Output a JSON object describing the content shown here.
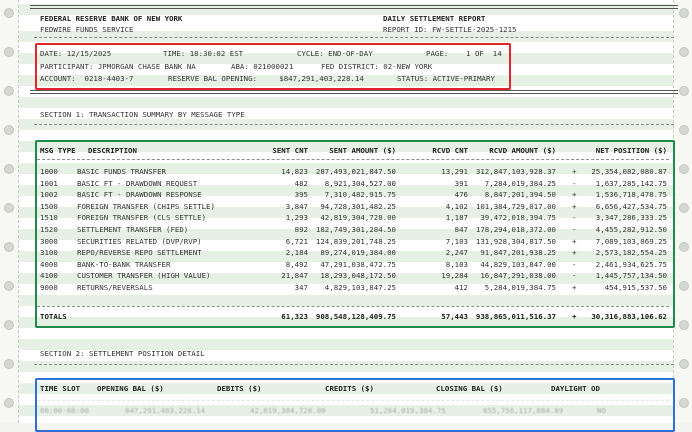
{
  "header": {
    "bank": "FEDERAL RESERVE BANK OF NEW YORK",
    "service": "FEDWIRE FUNDS SERVICE",
    "report_title": "DAILY SETTLEMENT REPORT",
    "report_id": "REPORT ID: FW-SETTLE-2025-1215"
  },
  "info": {
    "date": "DATE: 12/15/2025",
    "time": "TIME: 18:30:02 EST",
    "cycle": "CYCLE: END-OF-DAY",
    "page": "PAGE:    1 OF  14",
    "participant": "PARTICIPANT: JPMORGAN CHASE BANK NA",
    "aba": "ABA: 021000021",
    "district": "FED DISTRICT: 02-NEW YORK",
    "account": "ACCOUNT:  0218-4403-7",
    "reserve": "RESERVE BAL OPENING:     $847,291,403,228.14",
    "status": "STATUS: ACTIVE-PRIMARY"
  },
  "section1": {
    "title": "SECTION 1: TRANSACTION SUMMARY BY MESSAGE TYPE",
    "columns": {
      "msg_type": "MSG TYPE",
      "description": "DESCRIPTION",
      "sent_cnt": "SENT CNT",
      "sent_amount": "SENT AMOUNT ($)",
      "rcvd_cnt": "RCVD CNT",
      "rcvd_amount": "RCVD AMOUNT ($)",
      "net_position": "NET POSITION ($)"
    },
    "rows": [
      {
        "type": "1000",
        "desc": "BASIC FUNDS TRANSFER",
        "sent_cnt": "14,823",
        "sent_amt": "287,493,021,847.50",
        "rcvd_cnt": "13,291",
        "rcvd_amt": "312,847,103,928.37",
        "sign": "+",
        "net": "25,354,082,080.87"
      },
      {
        "type": "1001",
        "desc": "BASIC FT - DRAWDOWN REQUEST",
        "sent_cnt": "482",
        "sent_amt": "8,921,304,527.00",
        "rcvd_cnt": "391",
        "rcvd_amt": "7,284,019,384.25",
        "sign": "-",
        "net": "1,637,285,142.75"
      },
      {
        "type": "1002",
        "desc": "BASIC FT - DRAWDOWN RESPONSE",
        "sent_cnt": "395",
        "sent_amt": "7,310,482,915.75",
        "rcvd_cnt": "476",
        "rcvd_amt": "8,847,201,394.50",
        "sign": "+",
        "net": "1,536,718,478.75"
      },
      {
        "type": "1500",
        "desc": "FOREIGN TRANSFER (CHIPS SETTLE)",
        "sent_cnt": "3,847",
        "sent_amt": "94,728,301,482.25",
        "rcvd_cnt": "4,102",
        "rcvd_amt": "101,384,729,017.00",
        "sign": "+",
        "net": "6,656,427,534.75"
      },
      {
        "type": "1510",
        "desc": "FOREIGN TRANSFER (CLS SETTLE)",
        "sent_cnt": "1,293",
        "sent_amt": "42,819,304,728.00",
        "rcvd_cnt": "1,187",
        "rcvd_amt": "39,472,018,394.75",
        "sign": "-",
        "net": "3,347,286,333.25"
      },
      {
        "type": "1520",
        "desc": "SETTLEMENT TRANSFER (FED)",
        "sent_cnt": "892",
        "sent_amt": "182,749,301,284.50",
        "rcvd_cnt": "847",
        "rcvd_amt": "178,294,018,372.00",
        "sign": "-",
        "net": "4,455,282,912.50"
      },
      {
        "type": "3000",
        "desc": "SECURITIES RELATED (DVP/RVP)",
        "sent_cnt": "6,721",
        "sent_amt": "124,839,201,748.25",
        "rcvd_cnt": "7,103",
        "rcvd_amt": "131,928,304,817.50",
        "sign": "+",
        "net": "7,089,103,069.25"
      },
      {
        "type": "3100",
        "desc": "REPO/REVERSE REPO SETTLEMENT",
        "sent_cnt": "2,184",
        "sent_amt": "89,274,019,384.00",
        "rcvd_cnt": "2,247",
        "rcvd_amt": "91,847,201,938.25",
        "sign": "+",
        "net": "2,573,182,554.25"
      },
      {
        "type": "4000",
        "desc": "BANK-TO-BANK TRANSFER",
        "sent_cnt": "8,492",
        "sent_amt": "47,291,038,472.75",
        "rcvd_cnt": "8,103",
        "rcvd_amt": "44,829,103,847.00",
        "sign": "-",
        "net": "2,461,934,625.75"
      },
      {
        "type": "4100",
        "desc": "CUSTOMER TRANSFER (HIGH VALUE)",
        "sent_cnt": "21,847",
        "sent_amt": "18,293,048,172.50",
        "rcvd_cnt": "19,284",
        "rcvd_amt": "16,847,291,038.00",
        "sign": "-",
        "net": "1,445,757,134.50"
      },
      {
        "type": "9000",
        "desc": "RETURNS/REVERSALS",
        "sent_cnt": "347",
        "sent_amt": "4,829,103,847.25",
        "rcvd_cnt": "412",
        "rcvd_amt": "5,284,019,384.75",
        "sign": "+",
        "net": "454,915,537.50"
      }
    ],
    "totals": {
      "label": "TOTALS",
      "sent_cnt": "61,323",
      "sent_amt": "908,548,128,409.75",
      "rcvd_cnt": "57,443",
      "rcvd_amt": "938,865,011,516.37",
      "sign": "+",
      "net": "30,316,883,106.62"
    }
  },
  "section2": {
    "title": "SECTION 2: SETTLEMENT POSITION DETAIL",
    "columns": {
      "time_slot": "TIME SLOT",
      "opening": "OPENING BAL ($)",
      "debits": "DEBITS ($)",
      "credits": "CREDITS ($)",
      "closing": "CLOSING BAL ($)",
      "daylight": "DAYLIGHT OD"
    },
    "rows": [
      {
        "slot": "06:00-08:00",
        "opening": "847,291,403,228.14",
        "debits": "42,819,304,728.00",
        "credits": "51,284,019,384.75",
        "closing": "855,756,117,884.89",
        "od": "NO"
      }
    ]
  }
}
